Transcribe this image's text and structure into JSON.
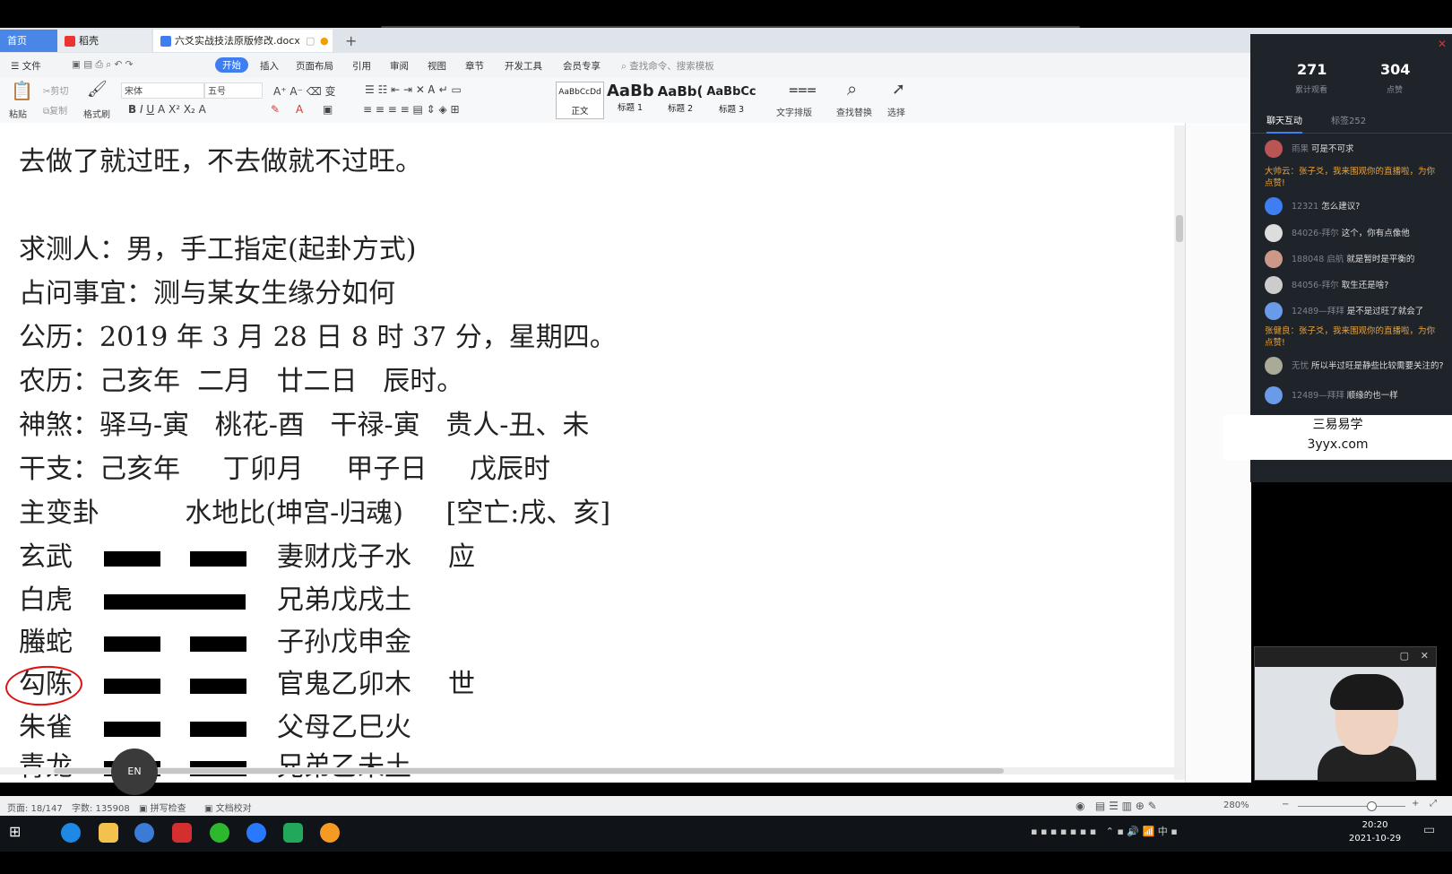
{
  "tabs": {
    "home": "首页",
    "draft": "稻壳",
    "doc": "六爻实战技法原版修改.docx",
    "add": "+"
  },
  "menu": {
    "file": "文件",
    "start": "开始",
    "insert": "插入",
    "layout": "页面布局",
    "ref": "引用",
    "review": "审阅",
    "view": "视图",
    "chapter": "章节",
    "dev": "开发工具",
    "vip": "会员专享",
    "search_placeholder": "查找命令、搜索模板"
  },
  "ribbon": {
    "paste": "粘贴",
    "cut": "剪切",
    "copy": "复制",
    "format_painter": "格式刷",
    "font": "宋体",
    "size": "五号",
    "style_normal_preview": "AaBbCcDd",
    "style_normal": "正文",
    "style_h1_preview": "AaBb",
    "style_h1": "标题 1",
    "style_h2_preview": "AaBb(",
    "style_h2": "标题 2",
    "style_h3_preview": "AaBbCc",
    "style_h3": "标题 3",
    "text_layout": "文字排版",
    "find_replace": "查找替换",
    "select": "选择"
  },
  "doc": {
    "line0": "去做了就过旺，不去做就不过旺。",
    "line1": "求测人：男，手工指定(起卦方式)",
    "line2": "占问事宜：测与某女生缘分如何",
    "line3": "公历：2019 年 3 月 28 日 8 时 37 分，星期四。",
    "line4": "农历：己亥年  二月   廿二日   辰时。",
    "line5": "神煞：驿马-寅   桃花-酉   干禄-寅   贵人-丑、未",
    "line6": "干支：己亥年     丁卯月     甲子日     戊辰时",
    "line7": "主变卦          水地比(坤宫-归魂)     [空亡:戌、亥]",
    "rows": [
      {
        "god": "玄武",
        "rel": "妻财戊子水",
        "mark": "应"
      },
      {
        "god": "白虎",
        "rel": "兄弟戊戌土",
        "mark": ""
      },
      {
        "god": "螣蛇",
        "rel": "子孙戊申金",
        "mark": ""
      },
      {
        "god": "勾陈",
        "rel": "官鬼乙卯木",
        "mark": "世"
      },
      {
        "god": "朱雀",
        "rel": "父母乙巳火",
        "mark": ""
      },
      {
        "god": "青龙",
        "rel": "兄弟乙未土",
        "mark": ""
      }
    ],
    "yao_types": [
      "yin",
      "yang",
      "yin",
      "yin",
      "yin",
      "yin"
    ]
  },
  "status": {
    "page": "页面: 18/147",
    "words": "字数: 135908",
    "spell": "拼写检查",
    "proof": "文档校对",
    "zoom": "280%"
  },
  "chat": {
    "viewers": "271",
    "viewers_label": "累计观看",
    "likes": "304",
    "likes_label": "点赞",
    "tab_chat": "聊天互动",
    "tab_count": "标签252",
    "messages": [
      {
        "name": "雨果",
        "text": "可是不可求",
        "sys": false
      },
      {
        "name": "大帅云",
        "text": "张子爻，我来围观你的直播啦，为你点赞!",
        "sys": true
      },
      {
        "name": "12321",
        "text": "怎么建议?",
        "sys": false
      },
      {
        "name": "84026-拜尔",
        "text": "这个，你有点像他",
        "sys": false
      },
      {
        "name": "188048 启航",
        "text": "就是暂时是平衡的",
        "sys": false
      },
      {
        "name": "84056-拜尔",
        "text": "取生还是啥?",
        "sys": false
      },
      {
        "name": "12489—拜拜",
        "text": "是不是过旺了就会了",
        "sys": false
      },
      {
        "name": "张健良",
        "text": "张子爻，我来围观你的直播啦，为你点赞!",
        "sys": true
      },
      {
        "name": "无忧",
        "text": "所以半过旺是静些比较需要关注的?",
        "sys": false
      },
      {
        "name": "12489—拜拜",
        "text": "顺缘的也一样",
        "sys": false
      }
    ]
  },
  "watermark": {
    "line1": "三易易学",
    "line2": "3yyx.com"
  },
  "clock": {
    "time": "20:20",
    "date": "2021-10-29"
  },
  "tray": {
    "ime": "中"
  },
  "en_toggle": "EN",
  "colors": {
    "accent": "#3f7ef0",
    "ink_circle": "#d11111",
    "chat_bg": "#1f242b",
    "chat_sys": "#e8a23a"
  }
}
